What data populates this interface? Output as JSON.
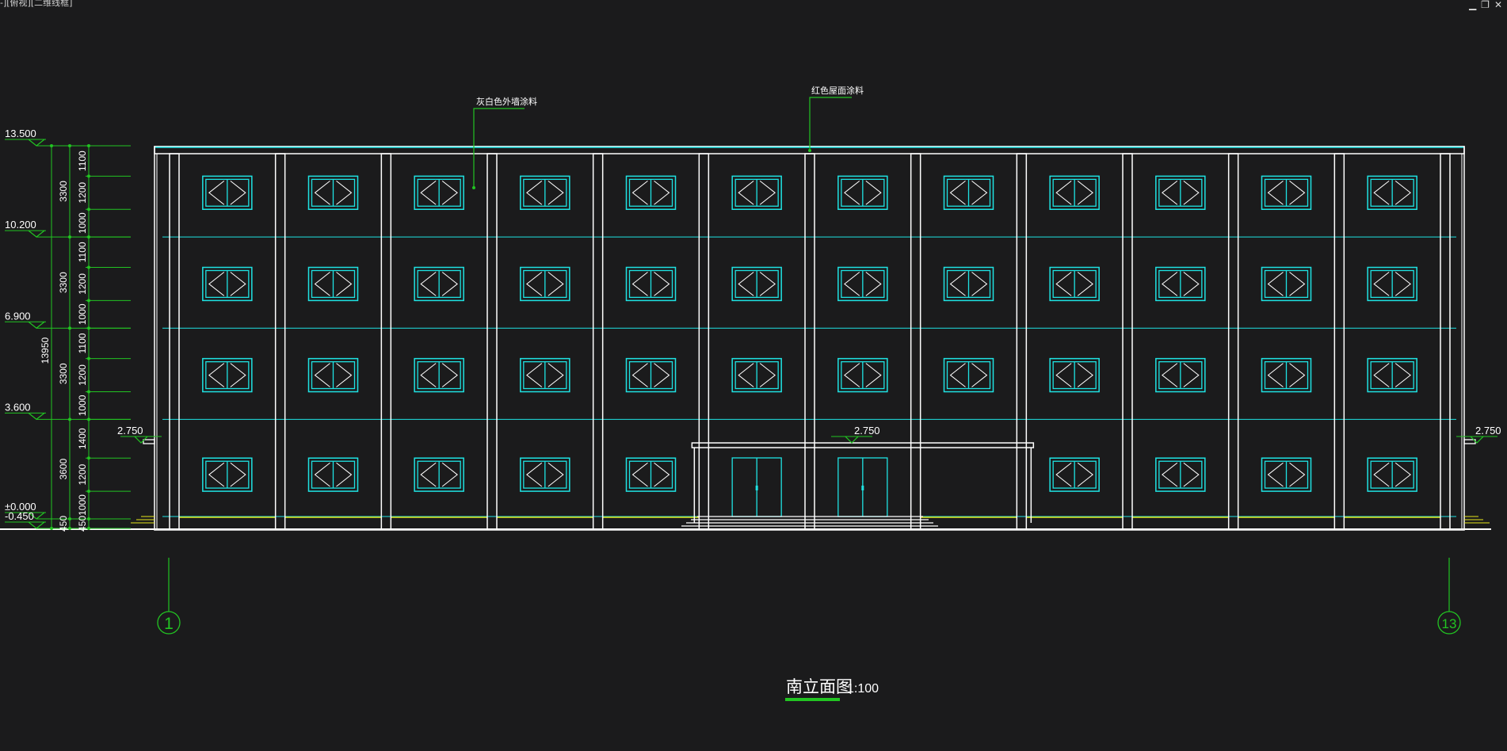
{
  "viewport": {
    "label": "-][俯视][二维线框]",
    "controls": {
      "minimize": "▁",
      "restore": "❐",
      "close": "✕"
    }
  },
  "colors": {
    "background": "#1b1b1c",
    "outline": "#ffffff",
    "window": "#1fe3e3",
    "dimension": "#22c422",
    "grade": "#e4e41a"
  },
  "drawing": {
    "title": "南立面图",
    "scale": "1:100",
    "axes": {
      "left": "1",
      "right": "13"
    },
    "annotations": {
      "wall_finish": "灰白色外墙涂料",
      "roof_finish": "红色屋面涂料"
    },
    "levels": [
      {
        "label": "13.500",
        "value": 13.5
      },
      {
        "label": "10.200",
        "value": 10.2
      },
      {
        "label": "6.900",
        "value": 6.9
      },
      {
        "label": "3.600",
        "value": 3.6
      },
      {
        "label": "±0.000",
        "value": 0
      },
      {
        "label": "-0.450",
        "value": -0.45
      }
    ],
    "canopy_levels": {
      "left": "2.750",
      "center": "2.750",
      "right": "2.750"
    },
    "total_height": "13950",
    "floor_heights": [
      "3300",
      "3300",
      "3300",
      "3600",
      "450"
    ],
    "segments": [
      {
        "label": "1100",
        "top": 13.5,
        "bottom": 12.4
      },
      {
        "label": "1200",
        "top": 12.4,
        "bottom": 11.2
      },
      {
        "label": "1000",
        "top": 11.2,
        "bottom": 10.2
      },
      {
        "label": "1100",
        "top": 10.2,
        "bottom": 9.1
      },
      {
        "label": "1200",
        "top": 9.1,
        "bottom": 7.9
      },
      {
        "label": "1000",
        "top": 7.9,
        "bottom": 6.9
      },
      {
        "label": "1100",
        "top": 6.9,
        "bottom": 5.8
      },
      {
        "label": "1200",
        "top": 5.8,
        "bottom": 4.6
      },
      {
        "label": "1000",
        "top": 4.6,
        "bottom": 3.6
      },
      {
        "label": "1400",
        "top": 3.6,
        "bottom": 2.2
      },
      {
        "label": "1200",
        "top": 2.2,
        "bottom": 1.0
      },
      {
        "label": "1000",
        "top": 1.0,
        "bottom": 0
      },
      {
        "label": "450",
        "top": 0,
        "bottom": -0.45
      }
    ],
    "bays": 12,
    "floors": 4,
    "entrance_bays": [
      5,
      6
    ]
  }
}
